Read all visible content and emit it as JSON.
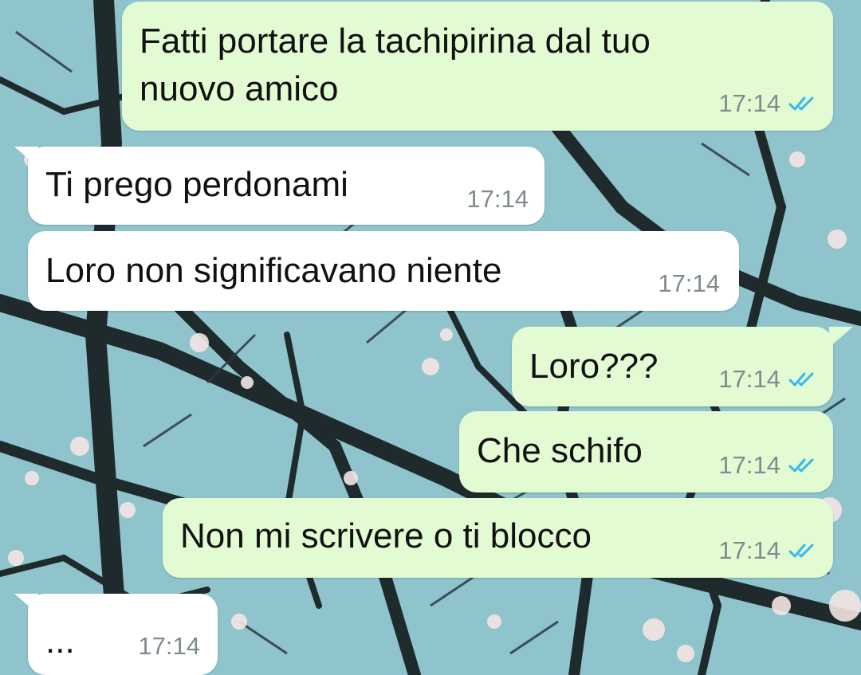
{
  "chat": {
    "colors": {
      "outgoing_bubble": "#e2fbd3",
      "incoming_bubble": "#ffffff",
      "read_ticks": "#34b7f1",
      "timestamp": "#7f8c8d"
    },
    "read_icon": "double-check-icon",
    "messages": [
      {
        "direction": "out",
        "line1": "Fatti portare la tachipirina dal tuo",
        "line2": "nuovo amico",
        "time": "17:14",
        "status": "read"
      },
      {
        "direction": "in",
        "text": "Ti prego perdonami",
        "time": "17:14"
      },
      {
        "direction": "in",
        "text": "Loro non significavano niente",
        "time": "17:14"
      },
      {
        "direction": "out",
        "text": "Loro???",
        "time": "17:14",
        "status": "read"
      },
      {
        "direction": "out",
        "text": "Che schifo",
        "time": "17:14",
        "status": "read"
      },
      {
        "direction": "out",
        "text": "Non mi scrivere o ti blocco",
        "time": "17:14",
        "status": "read"
      },
      {
        "direction": "in",
        "text": "...",
        "time": "17:14"
      }
    ]
  }
}
